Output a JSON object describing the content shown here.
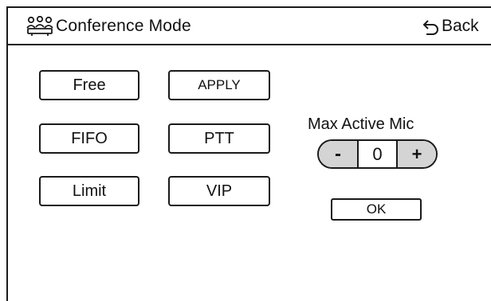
{
  "header": {
    "title": "Conference Mode",
    "icon": "conference-group-icon",
    "back_label": "Back",
    "back_icon": "undo-arrow-icon"
  },
  "modes": {
    "free": "Free",
    "fifo": "FIFO",
    "limit": "Limit",
    "apply": "APPLY",
    "ptt": "PTT",
    "vip": "VIP"
  },
  "max_active_mic": {
    "label": "Max Active Mic",
    "decrement_label": "-",
    "value": "0",
    "increment_label": "+"
  },
  "ok_label": "OK",
  "colors": {
    "line": "#1a1a1a",
    "stepper_button_fill": "#d4d4d4",
    "background": "#ffffff"
  }
}
